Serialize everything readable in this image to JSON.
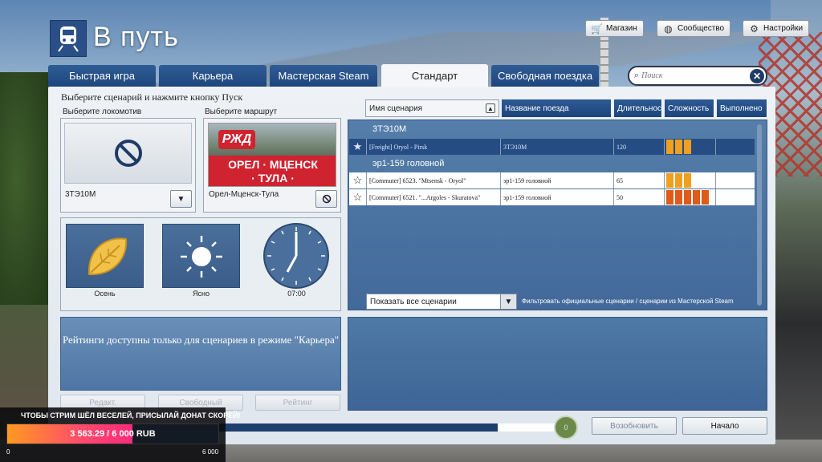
{
  "app": {
    "title": "В путь"
  },
  "top_buttons": {
    "shop": "Магазин",
    "community": "Сообщество",
    "settings": "Настройки"
  },
  "tabs": [
    {
      "label": "Быстрая игра"
    },
    {
      "label": "Карьера"
    },
    {
      "label": "Мастерская Steam"
    },
    {
      "label": "Стандарт",
      "active": true
    },
    {
      "label": "Свободная поездка"
    }
  ],
  "search": {
    "placeholder": "Поиск"
  },
  "instruction": "Выберите сценарий и нажмите кнопку Пуск",
  "locomotive": {
    "label": "Выберите локомотив",
    "name": "3ТЭ10М"
  },
  "route": {
    "label": "Выберите маршрут",
    "name": "Орел-Мценск-Тула",
    "banner_line1": "ОРЕЛ · МЦЕНСК",
    "banner_line2": "· ТУЛА ·",
    "logo": "РЖД"
  },
  "environment": {
    "season": "Осень",
    "weather": "Ясно",
    "time": "07:00"
  },
  "rating_note": "Рейтинги доступны только для сценариев в режиме \"Карьера\"",
  "lower_buttons": {
    "b1": "Редакт.",
    "b2": "Свободный",
    "b3": "Рейтинг"
  },
  "table": {
    "headers": [
      "Имя сценария",
      "Название поезда",
      "Длительнос",
      "Сложность",
      "Выполнено"
    ],
    "groups": [
      {
        "name": "3ТЭ10М",
        "rows": [
          {
            "name": "[Freight] Oryol - Pirsk",
            "train": "3ТЭ10М",
            "duration": "120",
            "difficulty": 3,
            "selected": true,
            "starred": true
          }
        ]
      },
      {
        "name": "эр1-159 головной",
        "rows": [
          {
            "name": "[Commuter] 6523. \"Mtsensk - Oryol\"",
            "train": "эр1-159 головной",
            "duration": "65",
            "difficulty": 3,
            "selected": false,
            "starred": false
          },
          {
            "name": "[Commuter] 6521. \"...Argoles - Skuratova\"",
            "train": "эр1-159 головной",
            "duration": "50",
            "difficulty": 5,
            "selected": false,
            "starred": false
          }
        ]
      }
    ]
  },
  "filter": {
    "selected": "Показать все сценарии",
    "note": "Фильтровать официальные сценарии / сценарии из Мастерской Steam"
  },
  "bottom": {
    "resume": "Возобновить",
    "start": "Начало",
    "knob": "0"
  },
  "donation": {
    "message": "ЧТОБЫ СТРИМ ШЁЛ ВЕСЕЛЕЙ, ПРИСЫЛАЙ ДОНАТ СКОРЕЙ!",
    "value": "3 563.29 / 6 000 RUB",
    "current": 3563.29,
    "goal": 6000,
    "min_label": "0",
    "max_label": "6 000"
  },
  "colors": {
    "accent": "#1f467d",
    "difficulty_fill": "#f0a020",
    "difficulty_hard": "#e05a1a",
    "donate_from": "#ff9a1f",
    "donate_to": "#ff2a7a"
  }
}
